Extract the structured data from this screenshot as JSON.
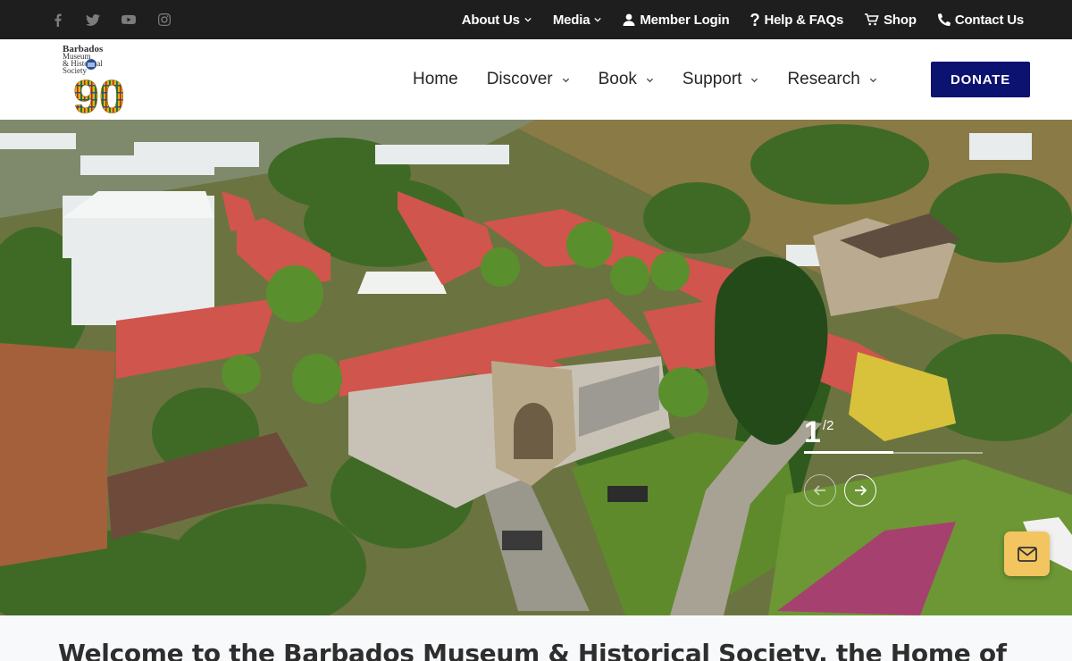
{
  "social": {
    "icons": [
      "facebook-icon",
      "twitter-icon",
      "youtube-icon",
      "instagram-icon"
    ],
    "color": "#7c7c7c"
  },
  "topnav": {
    "about": "About Us",
    "media": "Media",
    "login": "Member Login",
    "help": "Help & FAQs",
    "shop": "Shop",
    "contact": "Contact Us"
  },
  "logo": {
    "line1": "Barbados",
    "line2": "Museum",
    "line3": "& Historical",
    "line4": "Society",
    "number": "90"
  },
  "nav": {
    "home": "Home",
    "discover": "Discover",
    "book": "Book",
    "support": "Support",
    "research": "Research",
    "donate": "DONATE"
  },
  "slider": {
    "current": "1",
    "total": "/2",
    "progress": 0.5
  },
  "welcome": {
    "heading": "Welcome to the Barbados Museum & Historical Society, the Home of"
  },
  "colors": {
    "topbar": "#1e1e1e",
    "donate": "#0b1270",
    "mail_button": "#f2c561"
  }
}
